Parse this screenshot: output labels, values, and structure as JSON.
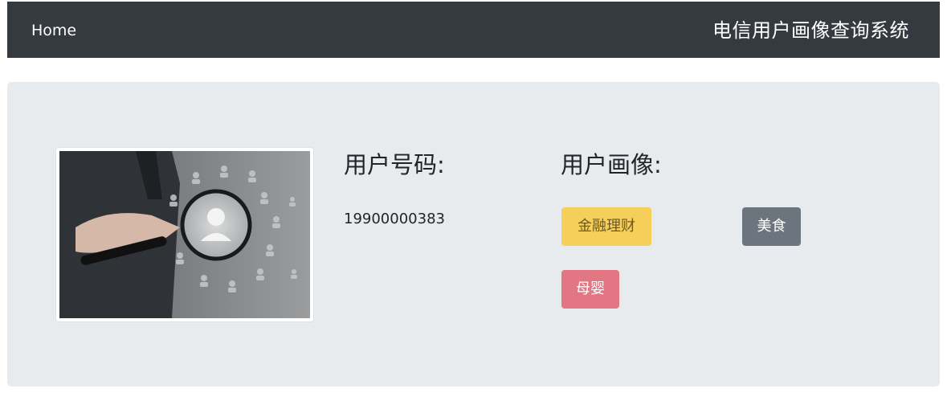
{
  "navbar": {
    "home_label": "Home",
    "title": "电信用户画像查询系统"
  },
  "main": {
    "image_alt": "magnifying-glass-user-search",
    "phone_label": "用户号码:",
    "phone_value": "19900000383",
    "profile_label": "用户画像:",
    "tags": [
      {
        "label": "金融理财",
        "color": "#f5cf5a"
      },
      {
        "label": "美食",
        "color": "#6c757d"
      },
      {
        "label": "母婴",
        "color": "#e27683"
      }
    ]
  }
}
